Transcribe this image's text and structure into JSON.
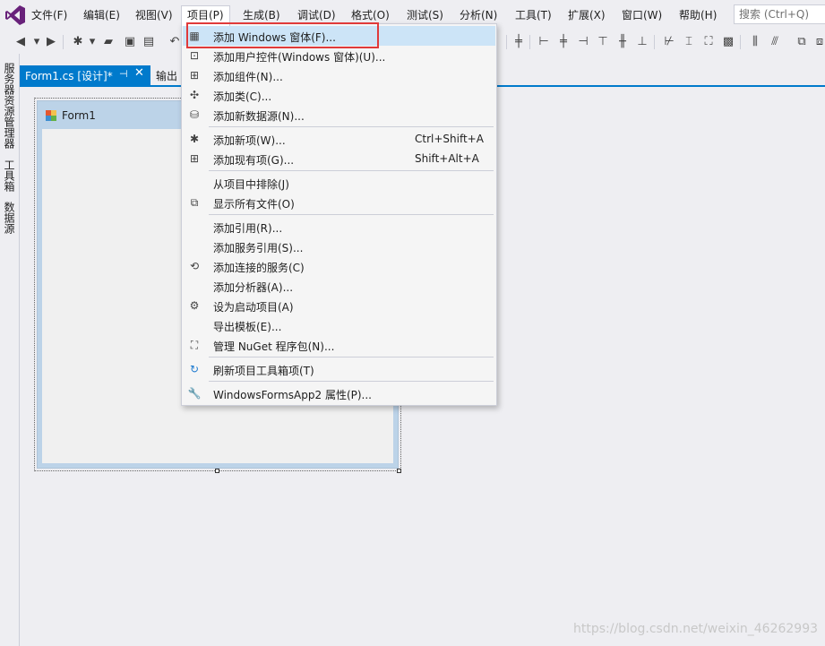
{
  "menubar": {
    "items": [
      "文件(F)",
      "编辑(E)",
      "视图(V)",
      "项目(P)",
      "生成(B)",
      "调试(D)",
      "格式(O)",
      "测试(S)",
      "分析(N)",
      "工具(T)",
      "扩展(X)",
      "窗口(W)",
      "帮助(H)"
    ],
    "search_placeholder": "搜索 (Ctrl+Q)"
  },
  "side_tabs": [
    "服务器资源管理器",
    "工具箱",
    "数据源"
  ],
  "doc_tabs": {
    "active": "Form1.cs [设计]*",
    "pin": "⊣",
    "close": "✕",
    "second": "输出"
  },
  "designer": {
    "form_title": "Form1"
  },
  "dropdown": {
    "items": [
      {
        "label": "添加 Windows 窗体(F)...",
        "shortcut": "",
        "icon": "add-form-icon"
      },
      {
        "label": "添加用户控件(Windows 窗体)(U)...",
        "shortcut": "",
        "icon": "add-user-control-icon"
      },
      {
        "label": "添加组件(N)...",
        "shortcut": "",
        "icon": "add-component-icon"
      },
      {
        "label": "添加类(C)...",
        "shortcut": "",
        "icon": "add-class-icon"
      },
      {
        "label": "添加新数据源(N)...",
        "shortcut": "",
        "icon": "add-datasource-icon"
      },
      {
        "label": "添加新项(W)...",
        "shortcut": "Ctrl+Shift+A",
        "icon": "add-new-item-icon"
      },
      {
        "label": "添加现有项(G)...",
        "shortcut": "Shift+Alt+A",
        "icon": "add-existing-item-icon"
      },
      {
        "label": "从项目中排除(J)",
        "shortcut": "",
        "icon": ""
      },
      {
        "label": "显示所有文件(O)",
        "shortcut": "",
        "icon": "show-all-files-icon"
      },
      {
        "label": "添加引用(R)...",
        "shortcut": "",
        "icon": ""
      },
      {
        "label": "添加服务引用(S)...",
        "shortcut": "",
        "icon": ""
      },
      {
        "label": "添加连接的服务(C)",
        "shortcut": "",
        "icon": "connected-service-icon"
      },
      {
        "label": "添加分析器(A)...",
        "shortcut": "",
        "icon": ""
      },
      {
        "label": "设为启动项目(A)",
        "shortcut": "",
        "icon": "gear-icon"
      },
      {
        "label": "导出模板(E)...",
        "shortcut": "",
        "icon": ""
      },
      {
        "label": "管理 NuGet 程序包(N)...",
        "shortcut": "",
        "icon": "nuget-icon"
      },
      {
        "label": "刷新项目工具箱项(T)",
        "shortcut": "",
        "icon": "refresh-icon"
      },
      {
        "label": "WindowsFormsApp2 属性(P)...",
        "shortcut": "",
        "icon": "wrench-icon"
      }
    ]
  },
  "watermark": "https://blog.csdn.net/weixin_46262993",
  "colors": {
    "accent": "#007acc",
    "highlight": "#cce4f7",
    "annotation": "#e03a3a"
  }
}
